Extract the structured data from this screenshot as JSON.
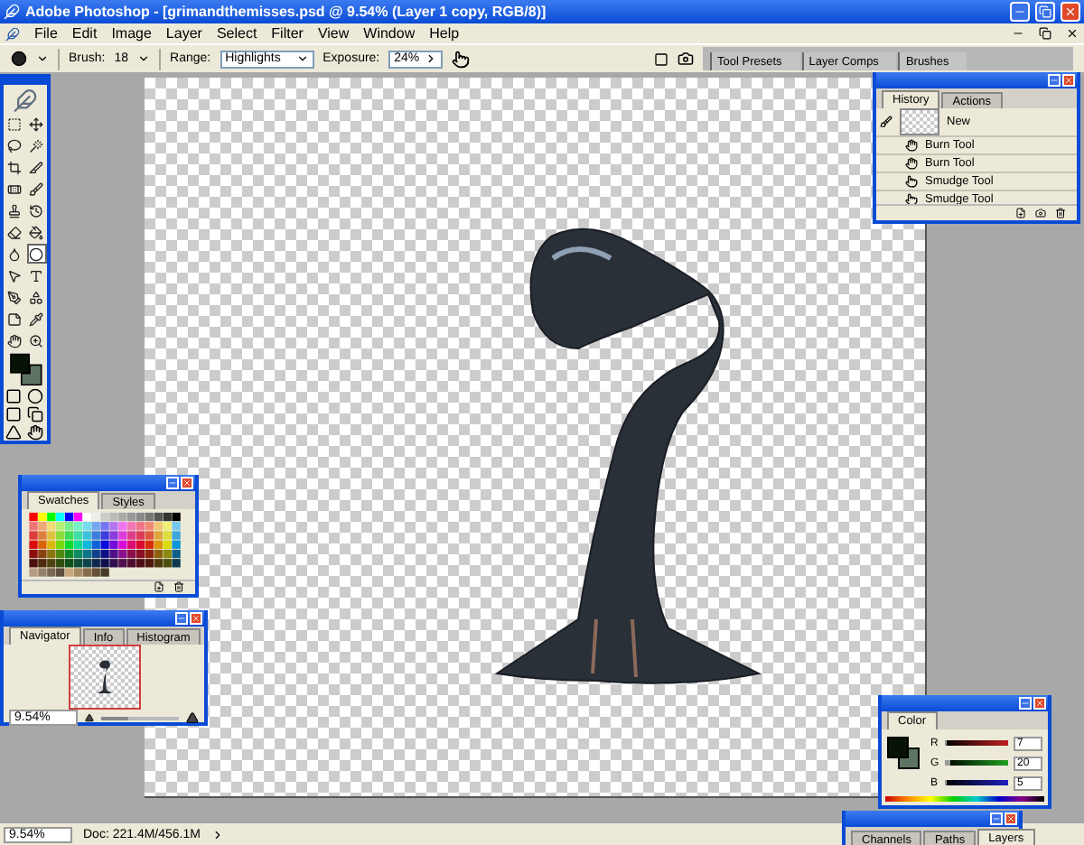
{
  "window": {
    "title": "Adobe Photoshop - [grimandthemisses.psd @ 9.54% (Layer 1 copy, RGB/8)]"
  },
  "menu": [
    "File",
    "Edit",
    "Image",
    "Layer",
    "Select",
    "Filter",
    "View",
    "Window",
    "Help"
  ],
  "options_bar": {
    "brush_label": "Brush:",
    "brush_size": "18",
    "range_label": "Range:",
    "range_value": "Highlights",
    "exposure_label": "Exposure:",
    "exposure_value": "24%"
  },
  "palette_well": [
    {
      "label": "Tool Presets"
    },
    {
      "label": "Layer Comps"
    },
    {
      "label": "Brushes"
    }
  ],
  "toolbox": {
    "tools": [
      {
        "selected": false
      },
      {
        "selected": false
      },
      {
        "selected": false
      },
      {
        "selected": false
      },
      {
        "selected": false
      },
      {
        "selected": false
      },
      {
        "selected": false
      },
      {
        "selected": false
      },
      {
        "selected": false
      },
      {
        "selected": false
      },
      {
        "selected": false
      },
      {
        "selected": false
      },
      {
        "selected": false
      },
      {
        "selected": true
      },
      {
        "selected": false
      },
      {
        "selected": false
      },
      {
        "selected": false
      },
      {
        "selected": false
      },
      {
        "selected": false
      },
      {
        "selected": false
      },
      {
        "selected": false
      },
      {
        "selected": false
      }
    ]
  },
  "history": {
    "tabs": [
      {
        "label": "History",
        "selected": true
      },
      {
        "label": "Actions",
        "selected": false
      }
    ],
    "snapshot": "New",
    "items": [
      {
        "kind": "burn",
        "label": "Burn Tool"
      },
      {
        "kind": "burn",
        "label": "Burn Tool"
      },
      {
        "kind": "smudge",
        "label": "Smudge Tool"
      },
      {
        "kind": "smudge",
        "label": "Smudge Tool"
      }
    ]
  },
  "swatches": {
    "tabs": [
      {
        "label": "Swatches",
        "selected": true
      },
      {
        "label": "Styles",
        "selected": false
      }
    ]
  },
  "navigator": {
    "tabs": [
      {
        "label": "Navigator",
        "selected": true
      },
      {
        "label": "Info",
        "selected": false
      },
      {
        "label": "Histogram",
        "selected": false
      }
    ],
    "zoom": "9.54%",
    "level": 0.35
  },
  "color": {
    "tabs": [
      {
        "label": "Color",
        "selected": true
      }
    ],
    "channels": [
      {
        "label": "R",
        "value": "7",
        "level": 0.03
      },
      {
        "label": "G",
        "value": "20",
        "level": 0.08
      },
      {
        "label": "B",
        "value": "5",
        "level": 0.02
      }
    ]
  },
  "layers": {
    "tabs": [
      {
        "label": "Channels",
        "selected": false
      },
      {
        "label": "Paths",
        "selected": false
      },
      {
        "label": "Layers",
        "selected": true
      }
    ]
  },
  "status_bar": {
    "zoom": "9.54%",
    "doc": "Doc: 221.4M/456.1M"
  }
}
